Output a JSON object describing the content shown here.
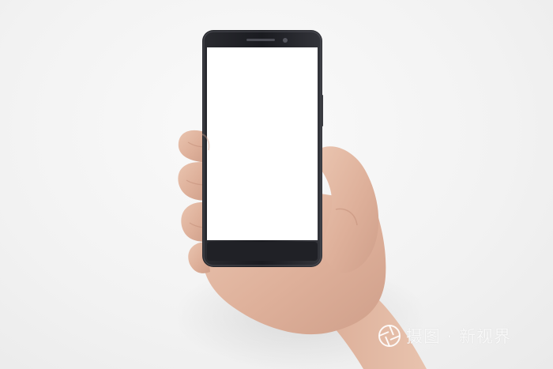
{
  "watermark": {
    "icon": "camera-aperture-icon",
    "text": "摄图 · 新视界"
  },
  "colors": {
    "background": "#f2f2f2",
    "phone_body": "#1c1d22",
    "screen": "#ffffff",
    "skin": "#e2b9a3",
    "skin_shadow": "#c9957f"
  }
}
